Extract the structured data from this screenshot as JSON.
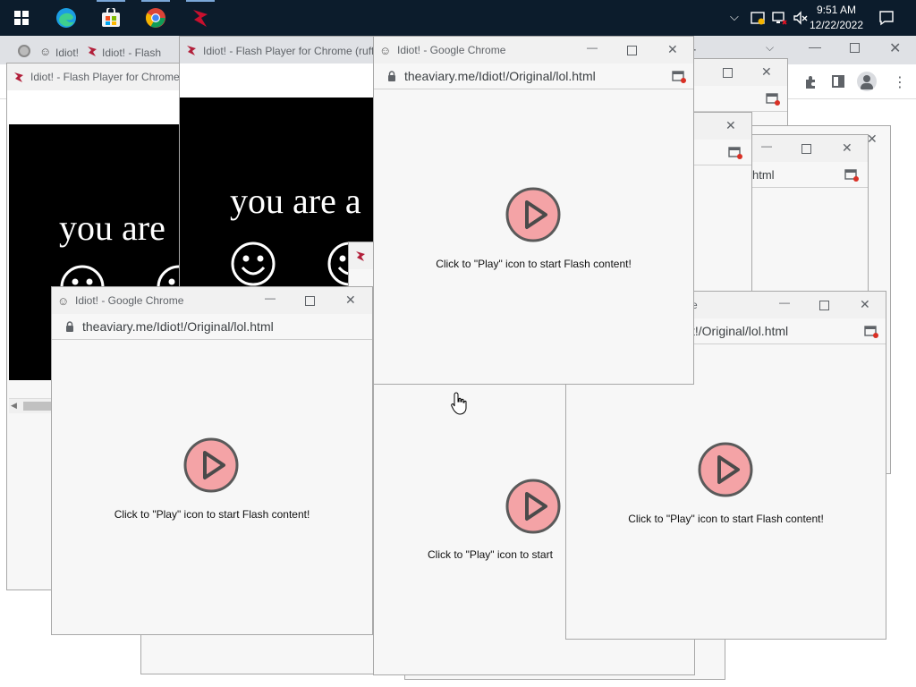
{
  "taskbar": {
    "apps": [
      "start-icon",
      "edge-icon",
      "store-icon",
      "chrome-icon",
      "flash-icon"
    ],
    "clock_time": "9:51 AM",
    "clock_date": "12/22/2022"
  },
  "chrome_window": {
    "tab1_title": "Idiot!",
    "tab2_title": "Idiot! - Flash",
    "tab3_title": "Idiot! - Flash Player for Chrome (ruffl"
  },
  "flash_window_left": {
    "title": "Idiot! - Flash Player for Chrome",
    "text": "you are"
  },
  "flash_window_mid": {
    "text": "you are a"
  },
  "popup_main": {
    "title": "Idiot! - Google Chrome",
    "url": "theaviary.me/Idiot!/Original/lol.html",
    "message": "Click to \"Play\" icon to start Flash content!"
  },
  "popup_left": {
    "title": "Idiot! - Google Chrome",
    "url": "theaviary.me/Idiot!/Original/lol.html",
    "message": "Click to \"Play\" icon to start Flash content!"
  },
  "popup_right": {
    "title_fragment": "e",
    "url_fragment": "t!/Original/lol.html",
    "message": "Click to \"Play\" icon to start Flash content!"
  },
  "popup_behind": {
    "url_fragment": "html"
  },
  "popup_bottom_mid": {
    "message": "Click to \"Play\" icon to start"
  },
  "colors": {
    "play_fill": "#f4a3a6",
    "play_stroke": "#5a5a5a",
    "taskbar": "#0c1c2c"
  }
}
